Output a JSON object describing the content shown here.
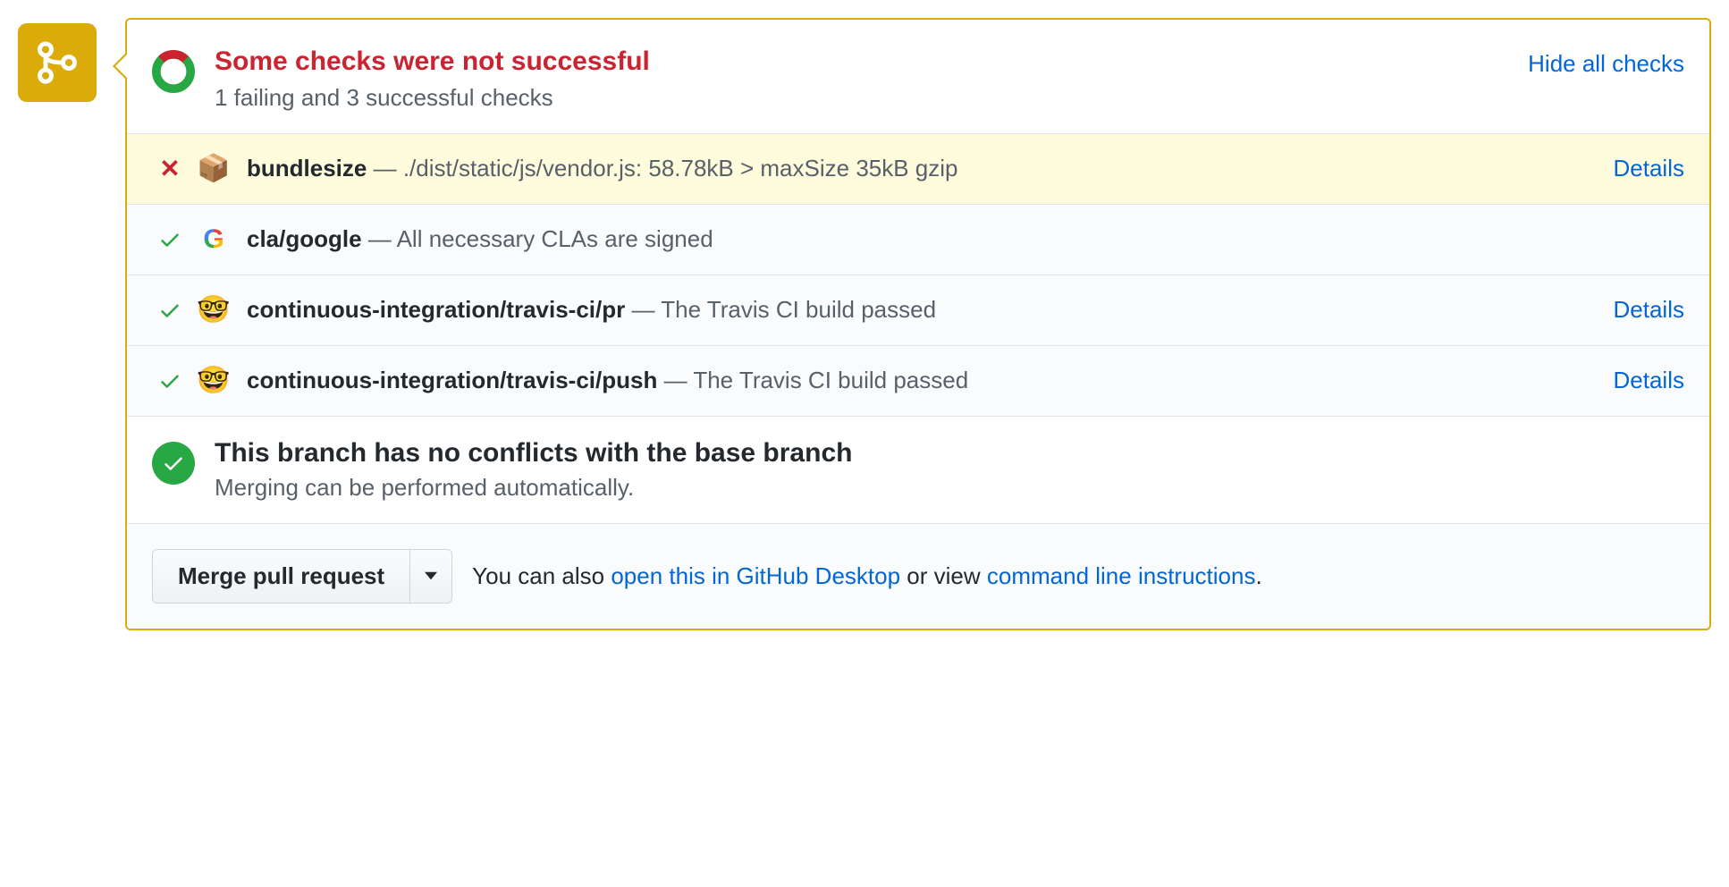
{
  "header": {
    "title": "Some checks were not successful",
    "subtitle": "1 failing and 3 successful checks",
    "hide_link": "Hide all checks"
  },
  "checks": [
    {
      "status": "fail",
      "icon": "package",
      "name": "bundlesize",
      "desc": "./dist/static/js/vendor.js: 58.78kB > maxSize 35kB gzip",
      "details": "Details"
    },
    {
      "status": "pass",
      "icon": "google",
      "name": "cla/google",
      "desc": "All necessary CLAs are signed",
      "details": ""
    },
    {
      "status": "pass",
      "icon": "travis",
      "name": "continuous-integration/travis-ci/pr",
      "desc": "The Travis CI build passed",
      "details": "Details"
    },
    {
      "status": "pass",
      "icon": "travis",
      "name": "continuous-integration/travis-ci/push",
      "desc": "The Travis CI build passed",
      "details": "Details"
    }
  ],
  "merge_status": {
    "title": "This branch has no conflicts with the base branch",
    "subtitle": "Merging can be performed automatically."
  },
  "footer": {
    "merge_button": "Merge pull request",
    "help_pre": "You can also ",
    "link1": "open this in GitHub Desktop",
    "help_mid": " or view ",
    "link2": "command line instructions",
    "help_post": "."
  }
}
